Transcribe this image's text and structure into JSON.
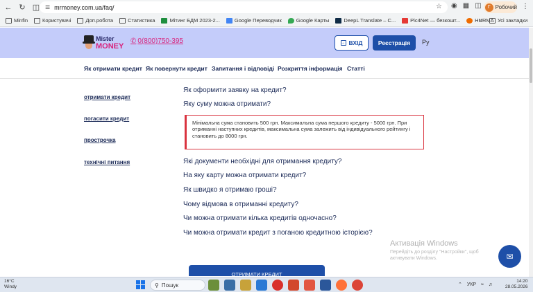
{
  "browser": {
    "url": "mrmoney.com.ua/faq/",
    "profile_initial": "Г",
    "profile_label": "Робочий",
    "bookmarks": [
      {
        "label": "Minfin",
        "icon": "folder"
      },
      {
        "label": "Користувачі",
        "icon": "folder"
      },
      {
        "label": "Доп.робота",
        "icon": "folder"
      },
      {
        "label": "Статистика",
        "icon": "folder"
      },
      {
        "label": "Мітинг БДМ 2023-2...",
        "icon": "sheet"
      },
      {
        "label": "Google Переводчик",
        "icon": "translate"
      },
      {
        "label": "Google Карты",
        "icon": "maps"
      },
      {
        "label": "DeepL Translate – С...",
        "icon": "deepl"
      },
      {
        "label": "Pic4Net — безкошт...",
        "icon": "pic4net"
      },
      {
        "label": "HURMA",
        "icon": "hurma"
      }
    ],
    "bookmarks_all": "Усі закладки"
  },
  "site": {
    "logo_top": "Mister",
    "logo_bottom": "MONEY",
    "phone": "0(800)750-395",
    "login_label": "ВХІД",
    "register_label": "Реєстрація",
    "lang": "Ру",
    "nav": [
      "Як отримати кредит",
      "Як повернути кредит",
      "Запитання і відповіді",
      "Розкриття інформація",
      "Статті"
    ],
    "sidebar": [
      "отримати кредит",
      "погасити кредит",
      "прострочка",
      "технічні питання"
    ],
    "faq": [
      "Як оформити заявку на кредит?",
      "Яку суму можна отримати?",
      "Які документи необхідні для отримання кредиту?",
      "На яку карту можна отримати кредит?",
      "Як швидко я отримаю гроші?",
      "Чому відмова в отриманні кредиту?",
      "Чи можна отримати кілька кредитів одночасно?",
      "Чи можна отримати кредит з поганою кредитною історією?"
    ],
    "answer": "Мінімальна сума становить 500 грн. Максимальна сума першого кредиту - 5000 грн. При отриманні наступних кредитів, максимальна сума залежить від індивідуального рейтингу і становить до 8000 грн.",
    "cta": "ОТРИМАТИ КРЕДИТ"
  },
  "watermark": {
    "title": "Активація Windows",
    "text": "Перейдіть до розділу \"Настройки\", щоб активувати Windows."
  },
  "taskbar": {
    "temp": "16°C",
    "weather": "Windy",
    "search": "Пошук",
    "lang": "УКР",
    "time": "14:20",
    "date": "28.05.2026"
  },
  "colors": {
    "header_bg": "#c4ccfa",
    "brand_blue": "#1e4fa8",
    "brand_pink": "#d8247d",
    "answer_border": "#d9333f"
  }
}
